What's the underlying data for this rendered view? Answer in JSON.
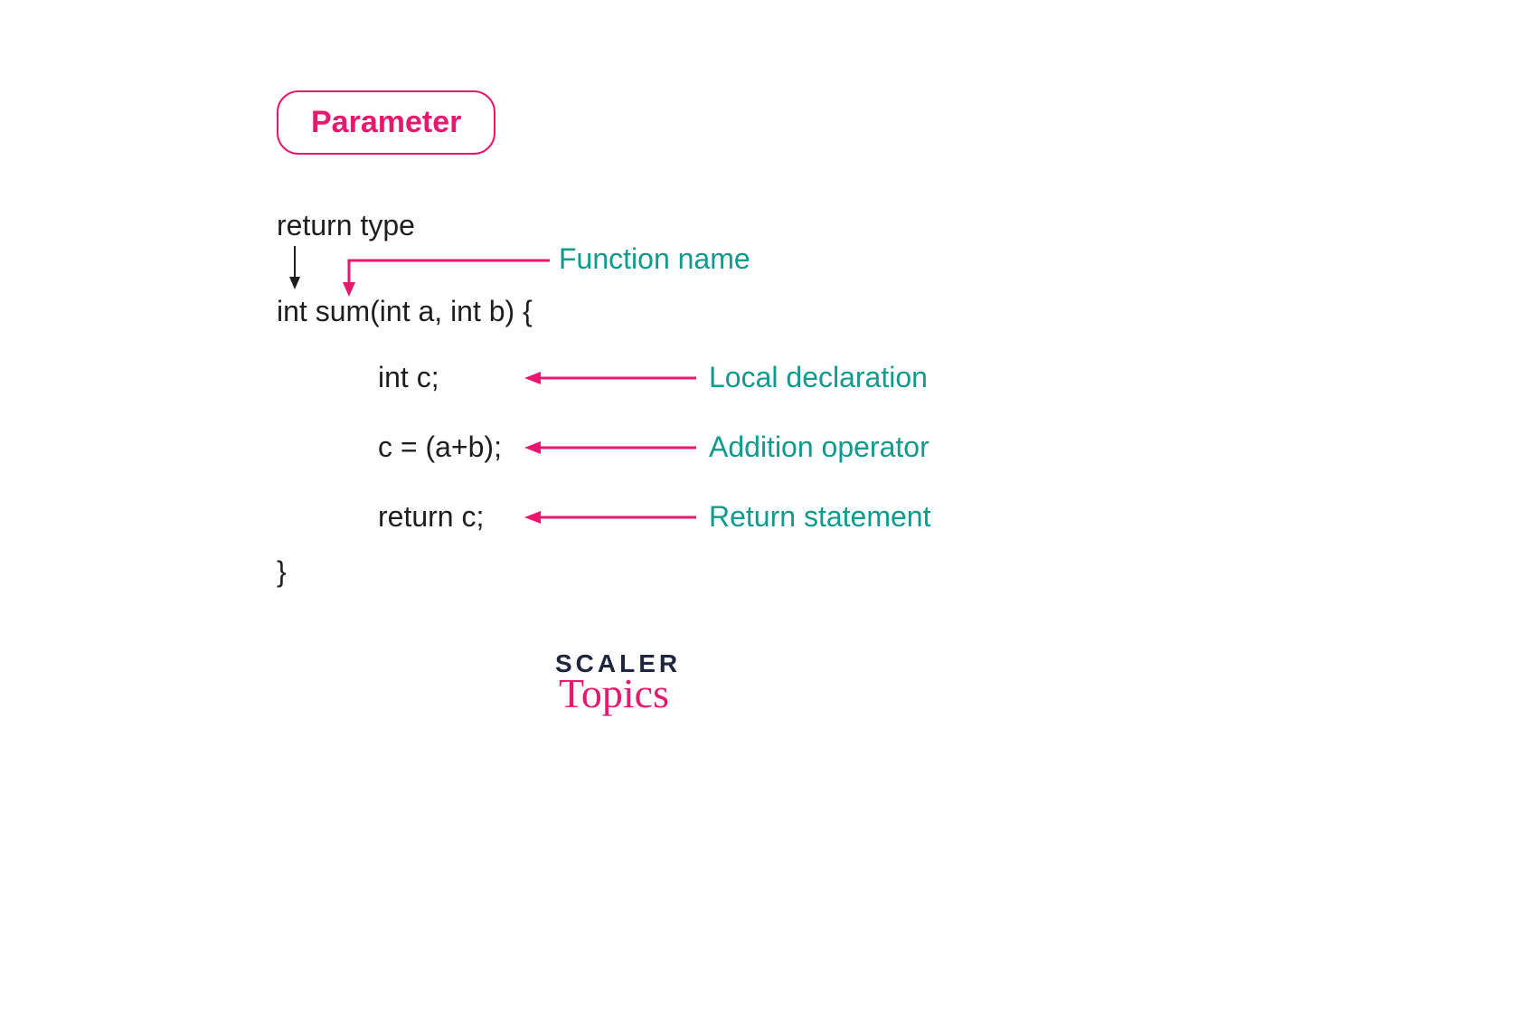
{
  "badge": {
    "label": "Parameter"
  },
  "code": {
    "return_type_label": "return type",
    "signature": "int sum(int a, int b) {",
    "line1": "int c;",
    "line2": "c = (a+b);",
    "line3": "return c;",
    "close": "}"
  },
  "annotations": {
    "function_name": "Function name",
    "local_declaration": "Local declaration",
    "addition_operator": "Addition operator",
    "return_statement": "Return statement"
  },
  "logo": {
    "line1": "SCALER",
    "line2": "Topics"
  },
  "colors": {
    "pink": "#e6196e",
    "teal": "#0f9a8e",
    "dark": "#1e1e1e",
    "navy": "#1f2640"
  }
}
